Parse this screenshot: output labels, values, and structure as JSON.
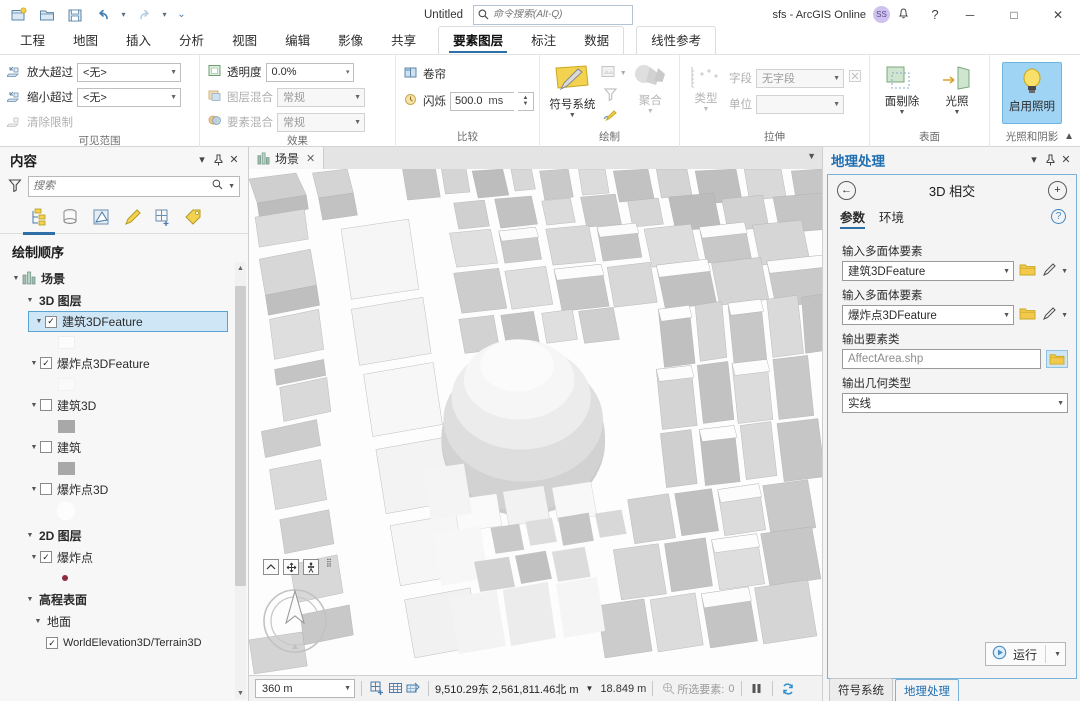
{
  "titlebar": {
    "quick_access": [
      {
        "name": "new-project-icon",
        "tip": "新建"
      },
      {
        "name": "open-project-icon",
        "tip": "打开"
      },
      {
        "name": "save-project-icon",
        "tip": "保存"
      },
      {
        "name": "undo-icon",
        "tip": "撤销"
      },
      {
        "name": "redo-icon",
        "tip": "重做"
      },
      {
        "name": "customize-qat-icon",
        "tip": "自定义快速访问工具栏"
      }
    ],
    "doc_title": "Untitled",
    "search_placeholder": "命令搜索(Alt-Q)",
    "search_value": "",
    "account": "sfs - ArcGIS Online",
    "avatar_initials": "SS",
    "notification_icon": "bell-icon",
    "help_label": "?",
    "minimize": "─",
    "maximize": "□",
    "close": "✕"
  },
  "ribbon": {
    "tabs": [
      "工程",
      "地图",
      "插入",
      "分析",
      "视图",
      "编辑",
      "影像",
      "共享"
    ],
    "contextual_group_1": [
      "要素图层",
      "标注",
      "数据"
    ],
    "contextual_group_2": [
      "线性参考"
    ],
    "active_tab": "要素图层",
    "groups": [
      {
        "label": "可见范围",
        "rows": [
          {
            "icon": "zoom-in-beyond-icon",
            "label": "放大超过",
            "value": "<无>",
            "dim": false
          },
          {
            "icon": "zoom-out-beyond-icon",
            "label": "缩小超过",
            "value": "<无>",
            "dim": false
          },
          {
            "icon": "clear-limits-icon",
            "label": "清除限制",
            "value": null,
            "dim": true
          }
        ]
      },
      {
        "label": "效果",
        "rows": [
          {
            "icon": "transparency-icon",
            "label": "透明度",
            "value": "0.0%",
            "dim": false
          },
          {
            "icon": "layer-blend-icon",
            "label": "图层混合",
            "value": "常规",
            "dim": true
          },
          {
            "icon": "feature-blend-icon",
            "label": "要素混合",
            "value": "常规",
            "dim": true
          }
        ]
      },
      {
        "label": "比较",
        "rows": [
          {
            "icon": "swipe-icon",
            "label": "卷帘",
            "value": null,
            "dim": false
          },
          {
            "icon": "flash-icon",
            "label": "闪烁",
            "value": "500.0",
            "unit": "ms",
            "dim": false
          }
        ]
      },
      {
        "label": "绘制",
        "big_buttons": [
          {
            "icon": "symbology-icon",
            "label": "符号系统",
            "dim": false,
            "selected": false,
            "has_menu": true
          }
        ],
        "small_buttons": [
          {
            "icon": "import-symbology-icon",
            "dim": true,
            "has_menu": true
          },
          {
            "icon": "filter-icon",
            "dim": true
          },
          {
            "icon": "symbol-edit-icon",
            "dim": false
          }
        ],
        "aggregate": {
          "icon": "aggregation-icon",
          "label": "聚合",
          "dim": true,
          "has_menu": true
        }
      },
      {
        "label": "拉伸",
        "type_button": {
          "icon": "extrusion-type-icon",
          "label": "类型",
          "dim": true,
          "has_menu": true
        },
        "rows": [
          {
            "label": "字段",
            "value": "无字段",
            "dim": true
          },
          {
            "label": "单位",
            "value": "",
            "dim": true
          }
        ],
        "clear_button": {
          "icon": "clear-extrusion-icon",
          "dim": true
        }
      },
      {
        "label": "表面",
        "big_buttons": [
          {
            "icon": "face-culling-icon",
            "label": "面剔除",
            "dim": false,
            "has_menu": true
          },
          {
            "icon": "lighting-icon",
            "label": "光照",
            "dim": false,
            "has_menu": true
          }
        ]
      },
      {
        "label": "光照和阴影",
        "big_buttons": [
          {
            "icon": "enable-illumination-icon",
            "label": "启用照明",
            "dim": false,
            "selected": true
          }
        ]
      }
    ],
    "collapse_icon": "chevron-up-icon"
  },
  "contents_panel": {
    "title": "内容",
    "menu_icon": "chevron-down-icon",
    "pin_icon": "pin-icon",
    "close_icon": "close-icon",
    "filter_icon": "funnel-icon",
    "search_placeholder": "搜索",
    "search_value": "",
    "search_icon": "magnifier-icon",
    "search_menu_icon": "chevron-down-icon",
    "tabs": [
      {
        "name": "list-by-drawing-order",
        "icon": "drawing-order-icon",
        "active": true
      },
      {
        "name": "list-by-data-source",
        "icon": "database-icon",
        "active": false
      },
      {
        "name": "list-by-selection",
        "icon": "selection-icon",
        "active": false
      },
      {
        "name": "list-by-editing",
        "icon": "pencil-icon",
        "active": false
      },
      {
        "name": "list-by-snapping",
        "icon": "grid-plus-icon",
        "active": false
      },
      {
        "name": "list-by-labeling",
        "icon": "tag-icon",
        "active": false
      }
    ],
    "tree_header": "绘制顺序",
    "tree": [
      {
        "label": "场景",
        "indent": 0,
        "kind": "scene",
        "icon": "scene-icon",
        "checkbox": null,
        "bold": true
      },
      {
        "label": "3D 图层",
        "indent": 1,
        "kind": "group",
        "checkbox": null,
        "bold": true
      },
      {
        "label": "建筑3DFeature",
        "indent": 2,
        "kind": "layer",
        "checkbox": true,
        "selected": true,
        "swatch": "#fcfcfc"
      },
      {
        "label": "爆炸点3DFeature",
        "indent": 2,
        "kind": "layer",
        "checkbox": true,
        "selected": false,
        "swatch": "#fafafa"
      },
      {
        "label": "建筑3D",
        "indent": 2,
        "kind": "layer",
        "checkbox": false,
        "selected": false,
        "swatch": "#a8a8a8"
      },
      {
        "label": "建筑",
        "indent": 2,
        "kind": "layer",
        "checkbox": false,
        "selected": false,
        "swatch": "#a8a8a8"
      },
      {
        "label": "爆炸点3D",
        "indent": 2,
        "kind": "layer",
        "checkbox": false,
        "selected": false,
        "swatch": "sphere"
      },
      {
        "label": "2D 图层",
        "indent": 1,
        "kind": "group",
        "checkbox": null,
        "bold": true
      },
      {
        "label": "爆炸点",
        "indent": 2,
        "kind": "layer",
        "checkbox": true,
        "selected": false,
        "swatch": "dot"
      },
      {
        "label": "高程表面",
        "indent": 1,
        "kind": "group",
        "checkbox": null,
        "bold": true
      },
      {
        "label": "地面",
        "indent": 2,
        "kind": "group",
        "checkbox": null,
        "bold": false
      },
      {
        "label": "WorldElevation3D/Terrain3D",
        "indent": 3,
        "kind": "layer",
        "checkbox": true,
        "selected": false
      }
    ]
  },
  "view": {
    "tab_label": "场景",
    "tab_icon": "scene-icon",
    "tab_close": "✕",
    "menu_icon": "chevron-down-icon",
    "nav_buttons": [
      {
        "name": "full-extent-button",
        "glyph": "⌃"
      },
      {
        "name": "pan-button",
        "glyph": "✥"
      },
      {
        "name": "explore-button",
        "glyph": "Ὣ6"
      }
    ],
    "compass_icon": "navigator-compass"
  },
  "statusbar": {
    "scale": "360 m",
    "scale_arrow": "chevron-down-icon",
    "tools": [
      {
        "name": "add-grid-icon"
      },
      {
        "name": "show-grid-icon"
      },
      {
        "name": "coordinate-tool-icon"
      }
    ],
    "coordinates": "9,510.29东  2,561,811.46北  m",
    "coord_arrow": "chevron-down-icon",
    "elevation": "18.849 m",
    "selected_icon": "selected-features-icon",
    "selected_label": "所选要素:",
    "selected_count": "0",
    "pause_icon": "pause-icon",
    "refresh_icon": "refresh-icon"
  },
  "geoprocessing_panel": {
    "title": "地理处理",
    "menu_icon": "chevron-down-icon",
    "pin_icon": "pin-icon",
    "close_icon": "close-icon",
    "back_icon": "back-arrow-icon",
    "tool_name": "3D 相交",
    "add_icon": "plus-circle-icon",
    "tabs": [
      {
        "label": "参数",
        "active": true
      },
      {
        "label": "环境",
        "active": false
      }
    ],
    "help_icon": "question-circle-icon",
    "parameters": [
      {
        "label": "输入多面体要素",
        "value": "建筑3DFeature",
        "type": "combo",
        "ghost": false,
        "buttons": [
          "folder-icon",
          "pencil-icon",
          "chevron-down-icon"
        ]
      },
      {
        "label": "输入多面体要素",
        "value": "爆炸点3DFeature",
        "type": "combo",
        "ghost": false,
        "buttons": [
          "folder-icon",
          "pencil-icon",
          "chevron-down-icon"
        ]
      },
      {
        "label": "输出要素类",
        "value": "AffectArea.shp",
        "type": "text",
        "ghost": true,
        "buttons": [
          "folder-icon-highlight"
        ]
      },
      {
        "label": "输出几何类型",
        "value": "实线",
        "type": "combo-wide",
        "ghost": false,
        "buttons": []
      }
    ],
    "run_button": {
      "label": "运行",
      "icon": "run-icon",
      "menu_icon": "chevron-down-icon"
    },
    "bottom_tabs": [
      {
        "label": "符号系统",
        "active": false
      },
      {
        "label": "地理处理",
        "active": true
      }
    ]
  },
  "colors": {
    "accent": "#2f6fa8",
    "selection": "#cfe6f7",
    "panel_border": "#7ab2d8",
    "highlight_button": "#9fd4f5",
    "link": "#1f6fb2"
  }
}
